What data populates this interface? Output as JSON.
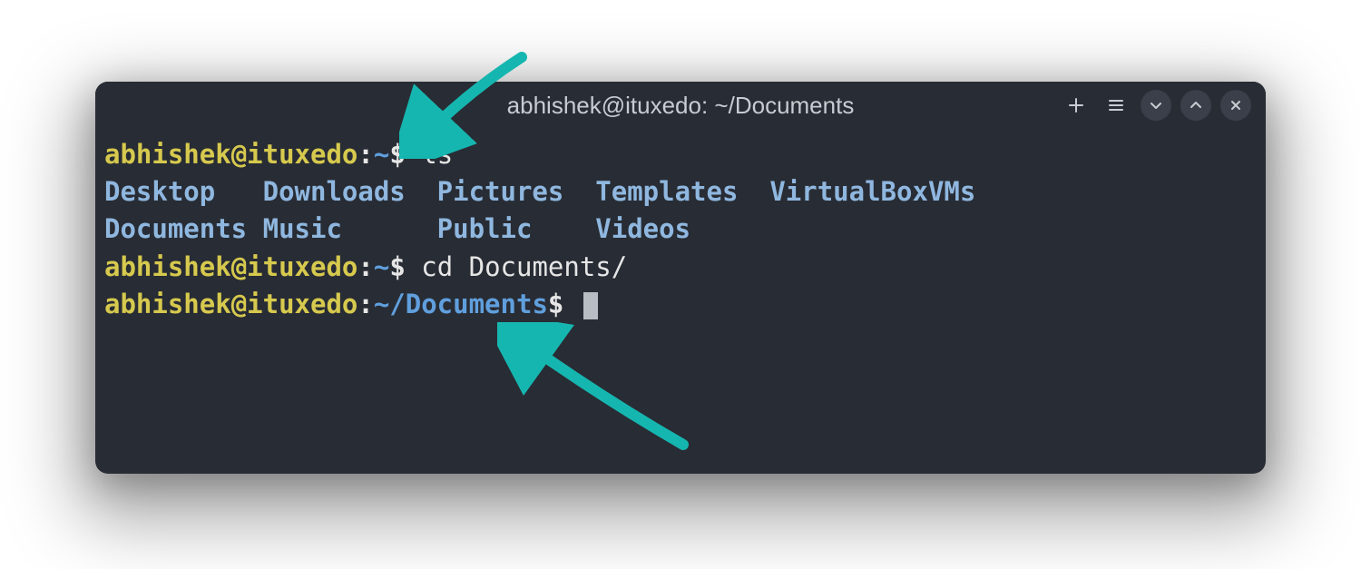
{
  "titlebar": {
    "title": "abhishek@ituxedo: ~/Documents"
  },
  "colors": {
    "accent_arrow": "#16b6b0",
    "prompt_user": "#d6c94e",
    "prompt_path": "#609fdd",
    "directory": "#8fb7df",
    "bg": "#282c34"
  },
  "terminal": {
    "lines": [
      {
        "type": "prompt",
        "user": "abhishek",
        "at": "@",
        "host": "ituxedo",
        "colon": ":",
        "path": "~",
        "dollar": "$ ",
        "command": "ls"
      },
      {
        "type": "ls-row",
        "cols": [
          "Desktop   ",
          "Downloads  ",
          "Pictures  ",
          "Templates  ",
          "VirtualBoxVMs"
        ]
      },
      {
        "type": "ls-row",
        "cols": [
          "Documents ",
          "Music      ",
          "Public    ",
          "Videos"
        ]
      },
      {
        "type": "prompt",
        "user": "abhishek",
        "at": "@",
        "host": "ituxedo",
        "colon": ":",
        "path": "~",
        "dollar": "$ ",
        "command": "cd Documents/"
      },
      {
        "type": "prompt",
        "user": "abhishek",
        "at": "@",
        "host": "ituxedo",
        "colon": ":",
        "path": "~/Documents",
        "dollar": "$ ",
        "command": "",
        "cursor": true
      }
    ]
  }
}
